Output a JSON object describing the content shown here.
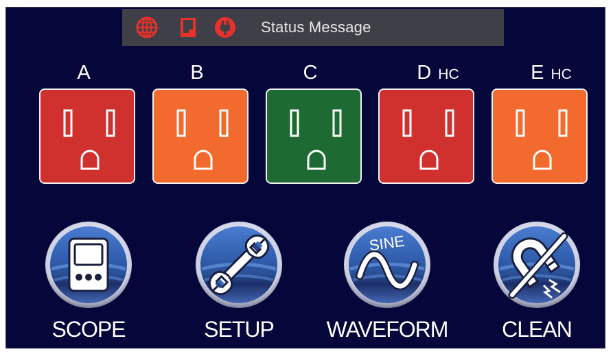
{
  "status": {
    "message": "Status Message",
    "icons": [
      "globe-icon",
      "sd-card-icon",
      "power-plug-icon"
    ],
    "icon_color": "#e8312a"
  },
  "outlets": [
    {
      "label": "A",
      "suffix": "",
      "color": "#d0302e"
    },
    {
      "label": "B",
      "suffix": "",
      "color": "#f26a2e"
    },
    {
      "label": "C",
      "suffix": "",
      "color": "#1d6b32"
    },
    {
      "label": "D",
      "suffix": "HC",
      "color": "#d0302e"
    },
    {
      "label": "E",
      "suffix": "HC",
      "color": "#f26a2e"
    }
  ],
  "buttons": [
    {
      "label": "SCOPE",
      "icon": "oscilloscope-icon"
    },
    {
      "label": "SETUP",
      "icon": "wrench-icon"
    },
    {
      "label": "WAVEFORM",
      "icon": "sine-wave-icon",
      "icon_text": "SINE"
    },
    {
      "label": "CLEAN",
      "icon": "magnet-crossed-icon"
    }
  ],
  "colors": {
    "background": "#05063a",
    "status_bar": "#3f3f47",
    "button_blue": "#3a63b0"
  }
}
